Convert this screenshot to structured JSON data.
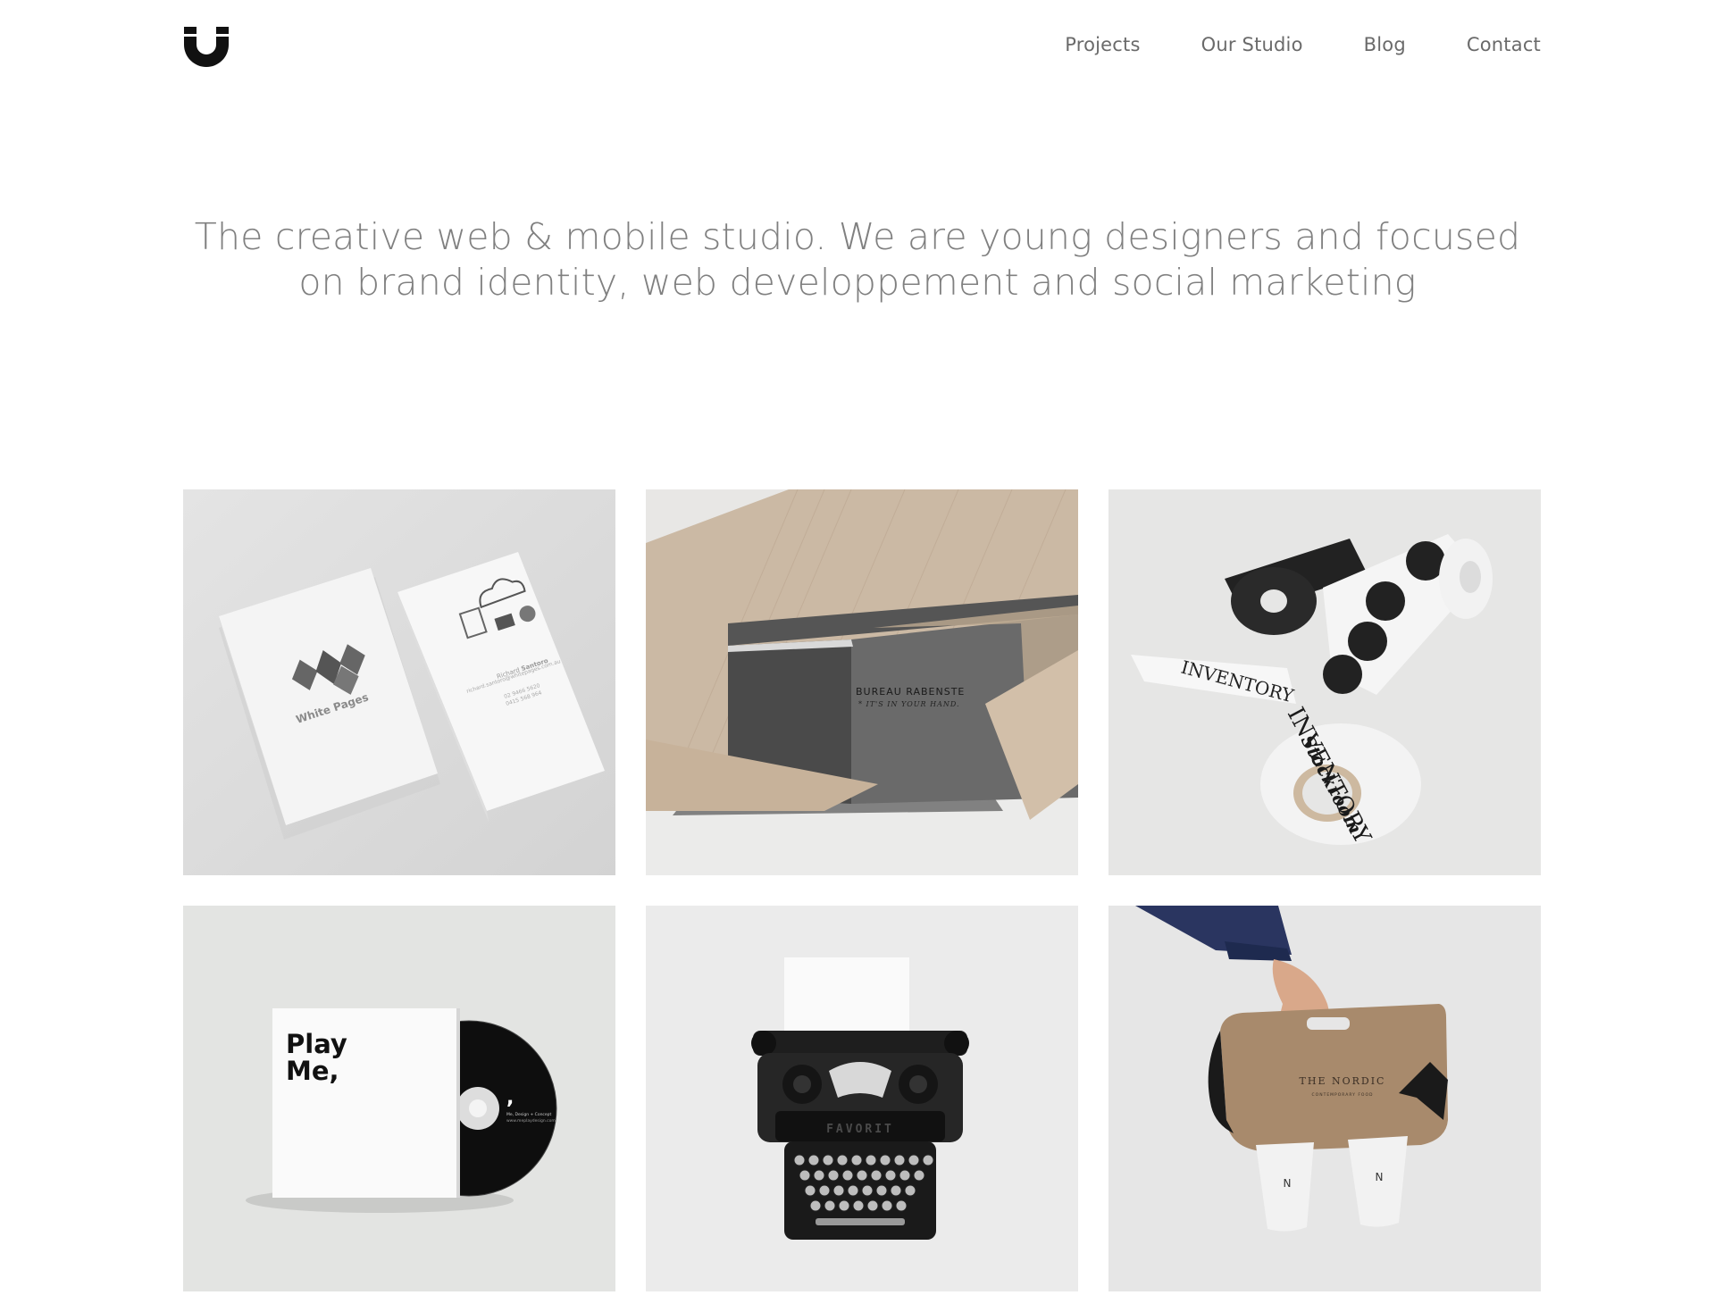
{
  "header": {
    "logo": {
      "icon": "magnet-u-logo-icon",
      "color": "#111111"
    },
    "nav": [
      {
        "label": "Projects"
      },
      {
        "label": "Our Studio"
      },
      {
        "label": "Blog"
      },
      {
        "label": "Contact"
      }
    ]
  },
  "hero": {
    "line1": "The creative web & mobile studio. We are young designers and focused",
    "line2": "on brand identity, web developpement and social marketing"
  },
  "projects": [
    {
      "image": "business-cards-mockup",
      "brand": "White Pages",
      "name_first": "Richard",
      "name_last": "Santoro",
      "email": "richard.santoro@whitepages.com.au",
      "phone1": "02 9466 5620",
      "phone2": "0415 568 964"
    },
    {
      "image": "card-box-kraft-paper",
      "brand": "BUREAU RABENSTE",
      "tagline": "* IT'S IN YOUR HAND."
    },
    {
      "image": "tape-and-sticker-rolls",
      "brand_line1": "INVENTORY",
      "brand_line2": "Stockroom"
    },
    {
      "image": "cd-sleeve-mockup",
      "title_line1": "Play",
      "title_line2": "Me,",
      "mark": ",",
      "disc_line1": "Me, Design + Concept",
      "disc_line2": "www.meplaydesign.com"
    },
    {
      "image": "vintage-typewriter",
      "brand": "FAVORIT"
    },
    {
      "image": "coffee-cup-carrier",
      "brand": "THE NORDIC",
      "sub": "CONTEMPORARY FOOD",
      "cup_mark": "N"
    }
  ]
}
